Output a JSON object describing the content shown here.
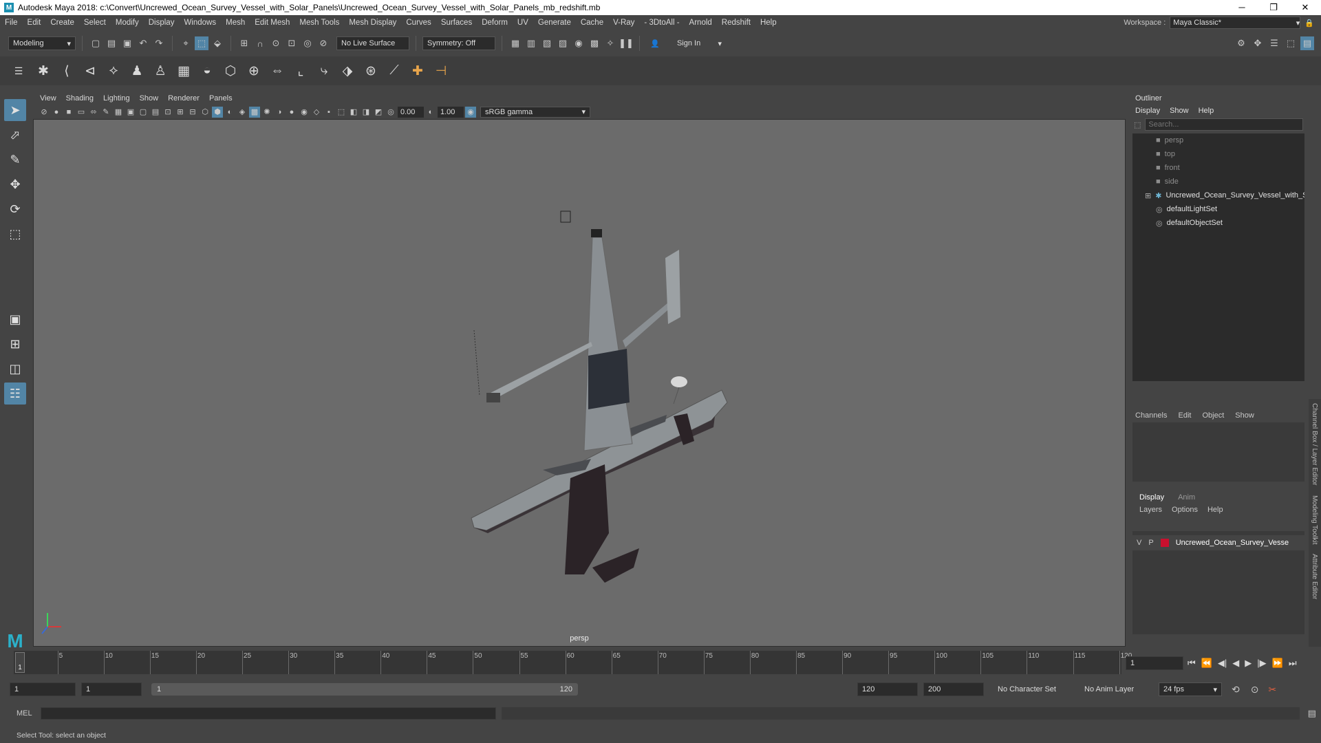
{
  "window": {
    "title": "Autodesk Maya 2018: c:\\Convert\\Uncrewed_Ocean_Survey_Vessel_with_Solar_Panels\\Uncrewed_Ocean_Survey_Vessel_with_Solar_Panels_mb_redshift.mb",
    "app_icon": "M",
    "minimize": "─",
    "maximize": "❐",
    "close": "✕"
  },
  "menubar": {
    "items": [
      "File",
      "Edit",
      "Create",
      "Select",
      "Modify",
      "Display",
      "Windows",
      "Mesh",
      "Edit Mesh",
      "Mesh Tools",
      "Mesh Display",
      "Curves",
      "Surfaces",
      "Deform",
      "UV",
      "Generate",
      "Cache",
      "V-Ray",
      "- 3DtoAll -",
      "Arnold",
      "Redshift",
      "Help"
    ],
    "workspace_label": "Workspace :",
    "workspace_value": "Maya Classic*"
  },
  "statusline": {
    "mode": "Modeling",
    "live_surface": "No Live Surface",
    "symmetry": "Symmetry: Off",
    "sign_in": "Sign In"
  },
  "viewport": {
    "menu": [
      "View",
      "Shading",
      "Lighting",
      "Show",
      "Renderer",
      "Panels"
    ],
    "exposure": "0.00",
    "gamma": "1.00",
    "color_space": "sRGB gamma",
    "camera_label": "persp"
  },
  "outliner": {
    "title": "Outliner",
    "menu": [
      "Display",
      "Show",
      "Help"
    ],
    "search_placeholder": "Search...",
    "items": [
      {
        "label": "persp",
        "dim": true,
        "icon": "camera-icon"
      },
      {
        "label": "top",
        "dim": true,
        "icon": "camera-icon"
      },
      {
        "label": "front",
        "dim": true,
        "icon": "camera-icon"
      },
      {
        "label": "side",
        "dim": true,
        "icon": "camera-icon"
      },
      {
        "label": "Uncrewed_Ocean_Survey_Vessel_with_S",
        "dim": false,
        "icon": "group-icon",
        "expandable": true
      },
      {
        "label": "defaultLightSet",
        "dim": false,
        "icon": "set-icon"
      },
      {
        "label": "defaultObjectSet",
        "dim": false,
        "icon": "set-icon"
      }
    ]
  },
  "channelbox": {
    "menu": [
      "Channels",
      "Edit",
      "Object",
      "Show"
    ]
  },
  "layereditor": {
    "tabs": [
      "Display",
      "Anim"
    ],
    "menu": [
      "Layers",
      "Options",
      "Help"
    ],
    "layer": {
      "v": "V",
      "p": "P",
      "name": "Uncrewed_Ocean_Survey_Vesse",
      "color": "#c8102e"
    }
  },
  "side_tabs": [
    "Channel Box / Layer Editor",
    "Modeling Toolkit",
    "Attribute Editor"
  ],
  "timeline": {
    "ticks": [
      "5",
      "10",
      "15",
      "20",
      "25",
      "30",
      "35",
      "40",
      "45",
      "50",
      "55",
      "60",
      "65",
      "70",
      "75",
      "80",
      "85",
      "90",
      "95",
      "100",
      "105",
      "110",
      "115",
      "120"
    ],
    "current_marker": "1",
    "current_frame": "1"
  },
  "range": {
    "start": "1",
    "playback_start": "1",
    "slider_start": "1",
    "slider_end": "120",
    "playback_end": "120",
    "end": "200",
    "character_set": "No Character Set",
    "anim_layer": "No Anim Layer",
    "fps": "24 fps"
  },
  "command": {
    "lang": "MEL"
  },
  "help_line": "Select Tool: select an object",
  "colors": {
    "accent": "#5285a6",
    "viewport_bg": "#6b6b6b",
    "hull": "#8e9396",
    "hull_dark": "#3a3337",
    "layer_color": "#c8102e"
  }
}
